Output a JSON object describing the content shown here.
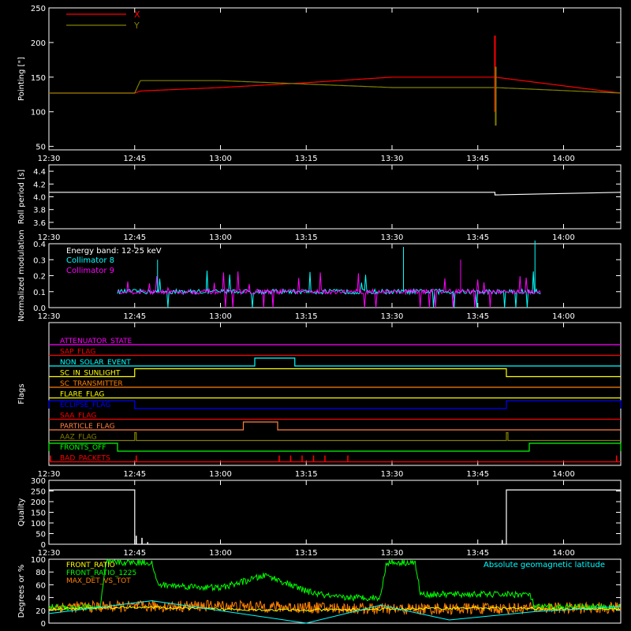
{
  "chart_data": [
    {
      "panel": "pointing",
      "type": "line",
      "ylabel": "Pointing [\"]",
      "ylim": [
        45,
        250
      ],
      "yticks": [
        50,
        100,
        150,
        200,
        250
      ],
      "xticks": [
        "12:30",
        "12:45",
        "13:00",
        "13:15",
        "13:30",
        "13:45",
        "14:00"
      ],
      "legend": [
        "X",
        "Y"
      ],
      "series": [
        {
          "name": "X",
          "color": "#ff0000",
          "x": [
            "12:30",
            "12:45",
            "12:46",
            "13:00",
            "13:15",
            "13:30",
            "13:48",
            "14:10"
          ],
          "y": [
            127,
            127,
            130,
            135,
            142,
            150,
            150,
            127
          ],
          "envelope": [
            0,
            0,
            75,
            50,
            12,
            22,
            22,
            0
          ]
        },
        {
          "name": "Y",
          "color": "#808000",
          "x": [
            "12:30",
            "12:45",
            "12:46",
            "13:00",
            "13:15",
            "13:30",
            "13:48",
            "14:10"
          ],
          "y": [
            127,
            127,
            145,
            145,
            140,
            135,
            135,
            127
          ],
          "envelope": [
            0,
            0,
            85,
            55,
            20,
            20,
            20,
            0
          ]
        }
      ]
    },
    {
      "panel": "roll-period",
      "type": "line",
      "ylabel": "Roll period [s]",
      "ylim": [
        3.5,
        4.5
      ],
      "yticks": [
        "3.6",
        "3.8",
        "4.0",
        "4.2",
        "4.4"
      ],
      "xticks": [
        "12:30",
        "12:45",
        "13:00",
        "13:15",
        "13:30",
        "13:45",
        "14:00"
      ],
      "series": [
        {
          "name": "",
          "color": "#ffffff",
          "x": [
            "12:30",
            "13:48",
            "13:48",
            "14:10"
          ],
          "y": [
            4.07,
            4.07,
            4.03,
            4.07
          ]
        }
      ]
    },
    {
      "panel": "modulation",
      "type": "line",
      "ylabel": "Normalized modulation",
      "ylim": [
        0,
        0.4
      ],
      "yticks": [
        "0.0",
        "0.1",
        "0.2",
        "0.3",
        "0.4"
      ],
      "xticks": [
        "12:30",
        "12:45",
        "13:00",
        "13:15",
        "13:30",
        "13:45",
        "14:00"
      ],
      "legend": [
        "Energy band: 12-25 keV",
        "Collimator 8",
        "Collimator 9"
      ],
      "series": [
        {
          "name": "Collimator 8",
          "color": "#00ffff",
          "x": [
            "12:42",
            "13:56"
          ],
          "baseline": 0.1
        },
        {
          "name": "Collimator 9",
          "color": "#ff00ff",
          "x": [
            "12:42",
            "13:56"
          ],
          "baseline": 0.1
        }
      ]
    },
    {
      "panel": "flags",
      "type": "line",
      "ylabel": "Flags",
      "xticks": [
        "12:30",
        "12:45",
        "13:00",
        "13:15",
        "13:30",
        "13:45",
        "14:00"
      ],
      "flags": [
        {
          "name": "ATTENUATOR_STATE",
          "color": "#ff00ff",
          "on": []
        },
        {
          "name": "SAP_FLAG",
          "color": "#ff0000",
          "on": []
        },
        {
          "name": "NON_SOLAR_EVENT",
          "color": "#00ffff",
          "on": [
            [
              "13:06",
              "13:13"
            ]
          ]
        },
        {
          "name": "SC_IN_SUNLIGHT",
          "color": "#ffff00",
          "on": [
            [
              "12:45",
              "13:50"
            ]
          ]
        },
        {
          "name": "SC_TRANSMITTER",
          "color": "#ff8000",
          "on": []
        },
        {
          "name": "FLARE_FLAG",
          "color": "#ffff00",
          "on": []
        },
        {
          "name": "ECLIPSE_FLAG",
          "color": "#0000ff",
          "on": [
            [
              "12:30",
              "12:45"
            ],
            [
              "13:50",
              "14:10"
            ]
          ]
        },
        {
          "name": "SAA_FLAG",
          "color": "#ff0000",
          "on": []
        },
        {
          "name": "PARTICLE_FLAG",
          "color": "#ff8040",
          "on": [
            [
              "13:04",
              "13:10"
            ]
          ]
        },
        {
          "name": "AAZ_FLAG",
          "color": "#808000",
          "on": [
            [
              "12:45",
              "12:45"
            ],
            [
              "13:50",
              "13:50"
            ]
          ]
        },
        {
          "name": "FRONTS_OFF",
          "color": "#00ff00",
          "on": [
            [
              "12:30",
              "12:42"
            ],
            [
              "13:54",
              "14:10"
            ]
          ]
        },
        {
          "name": "BAD_PACKETS",
          "color": "#ff0000",
          "spikes": [
            "12:30",
            "12:45",
            "13:10",
            "13:12",
            "13:14",
            "13:16",
            "13:18",
            "13:22",
            "14:09"
          ]
        }
      ]
    },
    {
      "panel": "quality",
      "type": "line",
      "ylabel": "Quality",
      "ylim": [
        0,
        300
      ],
      "yticks": [
        0,
        50,
        100,
        150,
        200,
        250,
        300
      ],
      "xticks": [
        "12:30",
        "12:45",
        "13:00",
        "13:15",
        "13:30",
        "13:45",
        "14:00"
      ],
      "series": [
        {
          "name": "",
          "color": "#ffffff",
          "x": [
            "12:30",
            "12:45",
            "12:45",
            "13:50",
            "13:50",
            "14:10"
          ],
          "y": [
            255,
            255,
            0,
            0,
            255,
            255
          ]
        }
      ]
    },
    {
      "panel": "geomag",
      "type": "line",
      "ylabel": "Degrees or %",
      "ylim": [
        0,
        100
      ],
      "yticks": [
        0,
        20,
        40,
        60,
        80,
        100
      ],
      "legend": [
        "FRONT_RATIO",
        "FRONT_RATIO_1225",
        "MAX_DET_VS_TOT"
      ],
      "annotation": "Absolute geomagnetic latitude",
      "series": [
        {
          "name": "FRONT_RATIO",
          "color": "#ffff00",
          "x": [
            "12:30",
            "12:45",
            "13:00",
            "13:15",
            "13:30",
            "13:45",
            "14:00",
            "14:10"
          ],
          "y": [
            22,
            25,
            22,
            20,
            22,
            24,
            22,
            22
          ]
        },
        {
          "name": "FRONT_RATIO_1225",
          "color": "#00ff00",
          "x": [
            "12:30",
            "12:39",
            "12:40",
            "12:48",
            "12:49",
            "13:00",
            "13:08",
            "13:15",
            "13:20",
            "13:28",
            "13:29",
            "13:34",
            "13:35",
            "13:46",
            "13:54",
            "13:55",
            "14:10"
          ],
          "y": [
            25,
            25,
            95,
            95,
            60,
            55,
            75,
            50,
            40,
            40,
            95,
            95,
            45,
            45,
            45,
            25,
            25
          ]
        },
        {
          "name": "MAX_DET_VS_TOT",
          "color": "#ff8000",
          "x": [
            "12:30",
            "13:00",
            "13:30",
            "14:10"
          ],
          "y": [
            25,
            27,
            22,
            24
          ]
        },
        {
          "name": "Absolute geomagnetic latitude",
          "color": "#00ffff",
          "x": [
            "12:30",
            "12:48",
            "13:15",
            "13:28",
            "13:40",
            "13:55",
            "14:10"
          ],
          "y": [
            15,
            35,
            0,
            28,
            5,
            18,
            26
          ]
        }
      ]
    }
  ]
}
